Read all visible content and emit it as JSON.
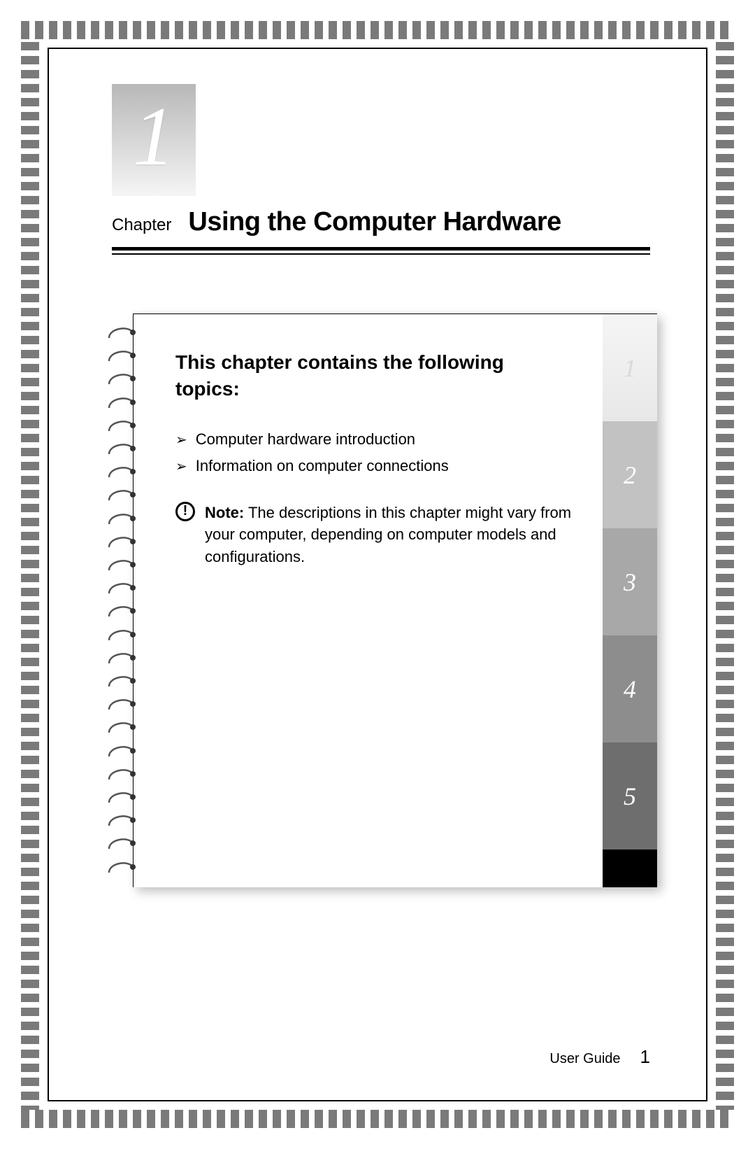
{
  "chapter": {
    "number": "1",
    "label": "Chapter",
    "title": "Using the Computer Hardware"
  },
  "topics": {
    "heading": "This chapter contains the following topics:",
    "items": [
      "Computer hardware introduction",
      "Information on computer connections"
    ]
  },
  "note": {
    "label": "Note:",
    "text": "The descriptions in this chapter might vary from your computer, depending on computer models and configurations."
  },
  "tabs": [
    "1",
    "2",
    "3",
    "4",
    "5"
  ],
  "footer": {
    "doc": "User Guide",
    "page": "1"
  }
}
